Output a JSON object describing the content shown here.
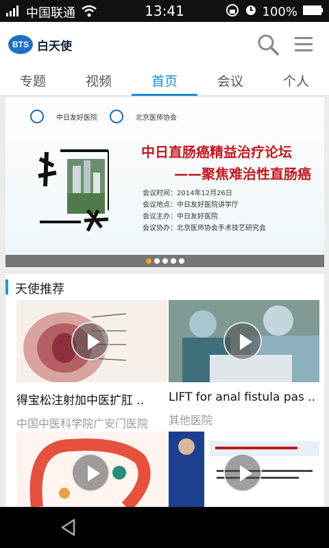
{
  "status": {
    "carrier": "中国联通",
    "time": "13:41",
    "battery": "100%"
  },
  "app": {
    "name": "白天使",
    "logo_badge": "BTS"
  },
  "tabs": [
    {
      "label": "专题"
    },
    {
      "label": "视频"
    },
    {
      "label": "首页"
    },
    {
      "label": "会议"
    },
    {
      "label": "个人"
    }
  ],
  "banner": {
    "org1": "中日友好医院",
    "org2": "北京医师协会",
    "title": "中日直肠癌精益治疗论坛",
    "subtitle": "——聚焦难治性直肠癌",
    "info": [
      "会议时间：2014年12月26日",
      "会议地点：中日友好医院讲学厅",
      "会议主办：中日友好医院",
      "会议协办：北京医师协会手术技艺研究会"
    ],
    "dots": 5,
    "active_dot": 0
  },
  "section": {
    "title": "天使推荐"
  },
  "cards": [
    {
      "title": "得宝松注射加中医扩肛 ..",
      "source": "中国中医科学院广安门医院"
    },
    {
      "title": "LIFT for anal fistula pas ..",
      "source": "其他医院"
    },
    {
      "title": "",
      "source": ""
    },
    {
      "title": "",
      "source": ""
    }
  ],
  "colors": {
    "accent": "#1a8bd2",
    "banner_red": "#c0191e"
  }
}
